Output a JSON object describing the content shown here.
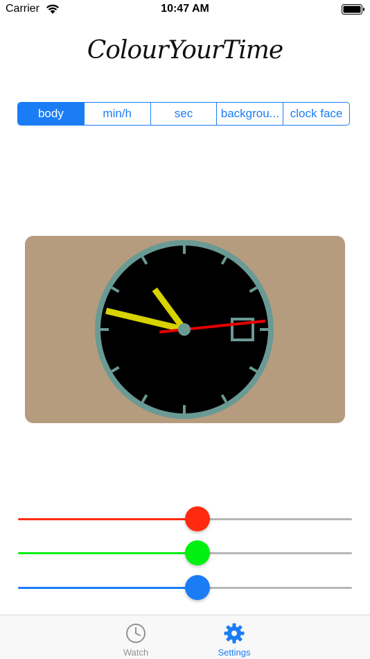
{
  "status_bar": {
    "carrier": "Carrier",
    "time": "10:47 AM"
  },
  "app": {
    "title": "ColourYourTime"
  },
  "segments": [
    {
      "label": "body",
      "selected": true
    },
    {
      "label": "min/h",
      "selected": false
    },
    {
      "label": "sec",
      "selected": false
    },
    {
      "label": "backgrou...",
      "selected": false
    },
    {
      "label": "clock face",
      "selected": false
    }
  ],
  "clock_preview": {
    "body_color": "#b69c7e",
    "face_color": "#000000",
    "rim_color": "#6a9a94",
    "hour_hand_color": "#d7d200",
    "minute_hand_color": "#d7d200",
    "second_hand_color": "#e60000",
    "hour": 10,
    "minute": 47,
    "second": 14
  },
  "sliders": [
    {
      "name": "red",
      "value": 0.5,
      "color": "#ff2a0f"
    },
    {
      "name": "green",
      "value": 0.5,
      "color": "#00f010"
    },
    {
      "name": "blue",
      "value": 0.5,
      "color": "#1a7df6"
    }
  ],
  "tab_bar": {
    "tabs": [
      {
        "label": "Watch",
        "icon": "clock-icon",
        "active": false
      },
      {
        "label": "Settings",
        "icon": "gear-icon",
        "active": true
      }
    ],
    "active_color": "#1a7df6",
    "inactive_color": "#929292"
  }
}
